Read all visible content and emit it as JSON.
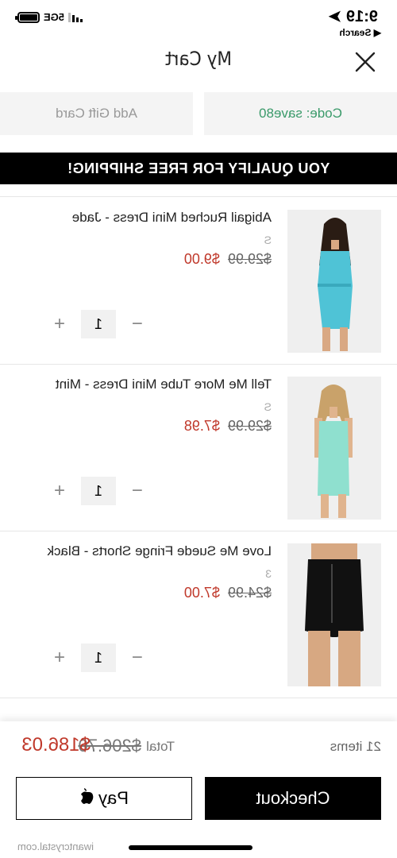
{
  "status": {
    "time": "9:19",
    "location_icon": "location-arrow-icon",
    "back_label": "◀ Search",
    "network": "5GE"
  },
  "header": {
    "title": "My Cart",
    "close_icon": "close-icon"
  },
  "promo": {
    "code_label": "Code: save80",
    "gift_label": "Add Gift Card"
  },
  "banner": {
    "text": "YOU QUALIFY FOR FREE SHIPPING!"
  },
  "items": [
    {
      "name": "Abigail Ruched Mini Dress - Jade",
      "size": "S",
      "sale_price": "$9.00",
      "original_price": "$29.99",
      "quantity": "1",
      "swatch": "#4fc3d6"
    },
    {
      "name": "Tell Me More Tube Mini Dress - Mint",
      "size": "S",
      "sale_price": "$7.98",
      "original_price": "$29.99",
      "quantity": "1",
      "swatch": "#8fe0cf"
    },
    {
      "name": "Love Me Suede Fringe Shorts - Black",
      "size": "3",
      "sale_price": "$7.00",
      "original_price": "$24.99",
      "quantity": "1",
      "swatch": "#111111"
    }
  ],
  "footer": {
    "items_count": "21 items",
    "total_label": "Total",
    "total_original": "$206.70",
    "total_sale": "$186.03",
    "checkout_label": "Checkout",
    "pay_label": "Pay",
    "watermark": "iwantcrystal.com"
  },
  "colors": {
    "accent_sale": "#c0392b",
    "promo_code": "#3a9a6a",
    "banner_bg": "#000000"
  }
}
